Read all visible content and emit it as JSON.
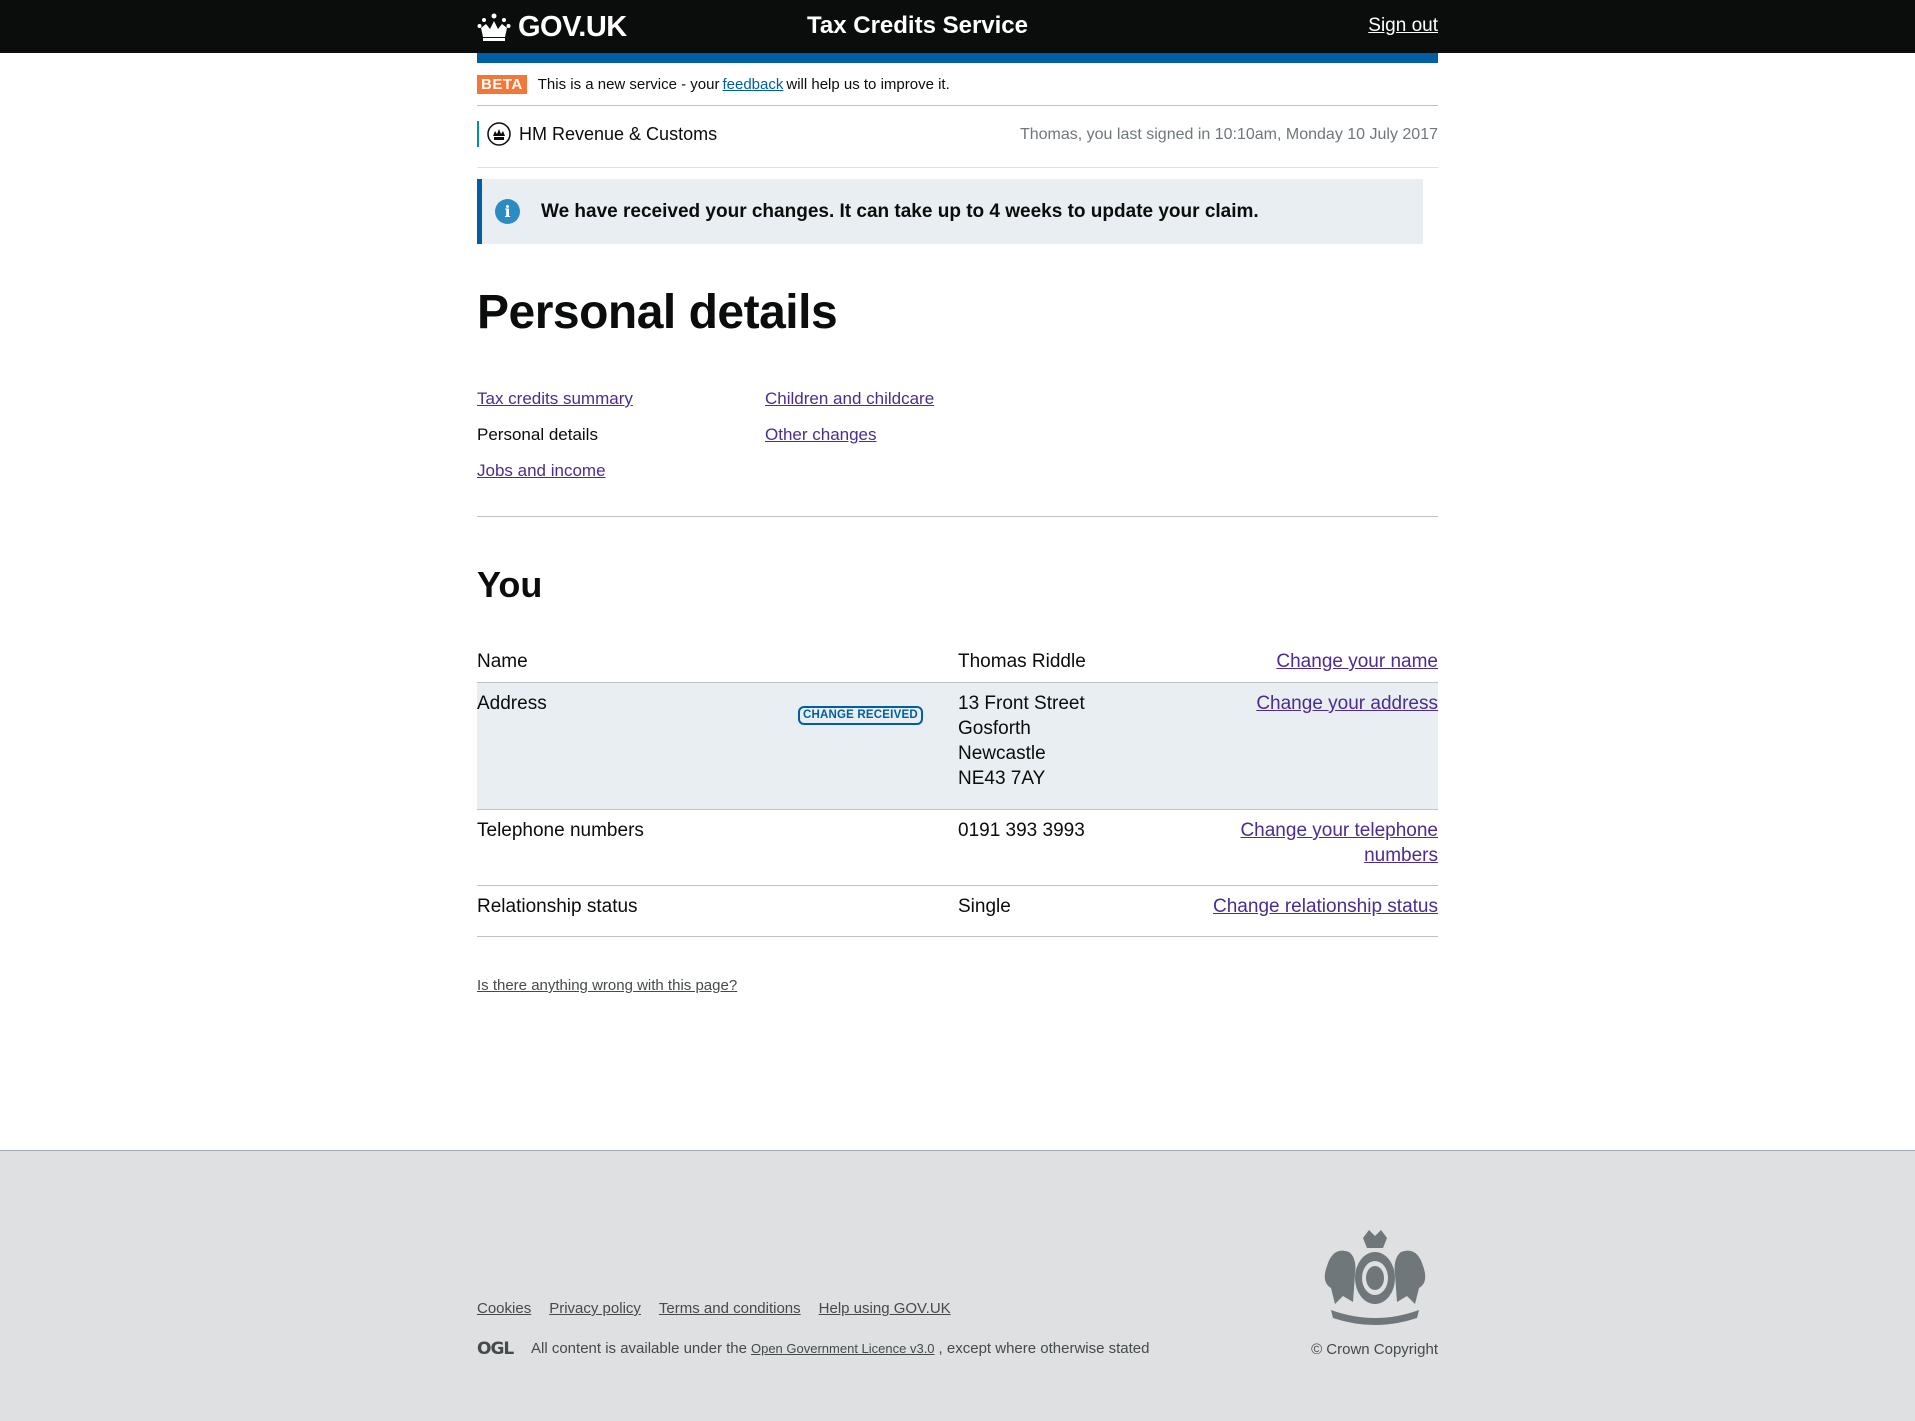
{
  "header": {
    "logo_text": "GOV.UK",
    "service_name": "Tax Credits Service",
    "sign_out": "Sign out"
  },
  "beta": {
    "tag": "BETA",
    "text_before": "This is a new service - your",
    "link": "feedback",
    "text_after": "will help us to improve it."
  },
  "hmrc": {
    "name": "HM Revenue & Customs",
    "last_signed_in": "Thomas, you last signed in 10:10am, Monday 10 July 2017"
  },
  "notice": {
    "icon": "i",
    "message": "We have received your changes. It can take up to 4 weeks to update your claim."
  },
  "page_title": "Personal details",
  "subnav": {
    "items": [
      {
        "label": "Tax credits summary",
        "current": false
      },
      {
        "label": "Personal details",
        "current": true
      },
      {
        "label": "Jobs and income",
        "current": false
      },
      {
        "label": "Children and childcare",
        "current": false
      },
      {
        "label": "Other changes",
        "current": false
      }
    ]
  },
  "section_title": "You",
  "rows": [
    {
      "key": "Name",
      "value": [
        "Thomas Riddle"
      ],
      "action": "Change your name"
    },
    {
      "key": "Address",
      "tag": "CHANGE RECEIVED",
      "value": [
        "13 Front Street",
        "Gosforth",
        "Newcastle",
        "NE43 7AY"
      ],
      "action": "Change your address"
    },
    {
      "key": "Telephone numbers",
      "value": [
        "0191 393 3993"
      ],
      "action": [
        "Change your telephone",
        "numbers"
      ]
    },
    {
      "key": "Relationship status",
      "value": [
        "Single"
      ],
      "action": "Change relationship status"
    }
  ],
  "report_link": "Is there anything wrong with this page?",
  "footer": {
    "links": [
      "Cookies",
      "Privacy policy",
      "Terms and conditions",
      "Help using GOV.UK"
    ],
    "licence_before": "All content is available under the",
    "licence_link": "Open Government Licence v3.0",
    "licence_after": ", except where otherwise stated",
    "copyright": "© Crown Copyright"
  }
}
